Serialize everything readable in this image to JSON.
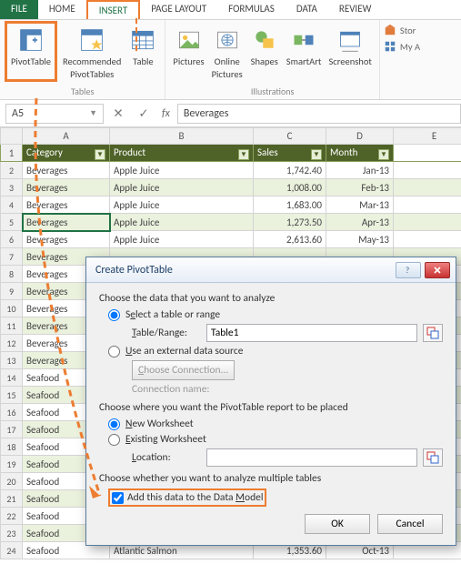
{
  "tabs": {
    "file": "FILE",
    "home": "HOME",
    "insert": "INSERT",
    "pagelayout": "PAGE LAYOUT",
    "formulas": "FORMULAS",
    "data": "DATA",
    "review": "REVIEW"
  },
  "ribbon": {
    "pivot": "PivotTable",
    "recpivot_l1": "Recommended",
    "recpivot_l2": "PivotTables",
    "table": "Table",
    "tables_group": "Tables",
    "pictures": "Pictures",
    "online_l1": "Online",
    "online_l2": "Pictures",
    "shapes": "Shapes",
    "smartart": "SmartArt",
    "screenshot": "Screenshot",
    "illus_group": "Illustrations",
    "store": "Stor",
    "myapps": "My A"
  },
  "namebox": "A5",
  "formula": "Beverages",
  "cols": [
    "A",
    "B",
    "C",
    "D",
    "E"
  ],
  "headers": {
    "category": "Category",
    "product": "Product",
    "sales": "Sales",
    "month": "Month"
  },
  "rows": [
    {
      "n": 2,
      "cat": "Beverages",
      "prod": "Apple Juice",
      "sales": "1,742.40",
      "mon": "Jan-13"
    },
    {
      "n": 3,
      "cat": "Beverages",
      "prod": "Apple Juice",
      "sales": "1,008.00",
      "mon": "Feb-13"
    },
    {
      "n": 4,
      "cat": "Beverages",
      "prod": "Apple Juice",
      "sales": "1,683.00",
      "mon": "Mar-13"
    },
    {
      "n": 5,
      "cat": "Beverages",
      "prod": "Apple Juice",
      "sales": "1,273.50",
      "mon": "Apr-13"
    },
    {
      "n": 6,
      "cat": "Beverages",
      "prod": "Apple Juice",
      "sales": "2,613.60",
      "mon": "May-13"
    },
    {
      "n": 7,
      "cat": "Beverages",
      "prod": "",
      "sales": "",
      "mon": ""
    },
    {
      "n": 8,
      "cat": "Beverages",
      "prod": "",
      "sales": "",
      "mon": ""
    },
    {
      "n": 9,
      "cat": "Beverages",
      "prod": "",
      "sales": "",
      "mon": ""
    },
    {
      "n": 10,
      "cat": "Beverages",
      "prod": "",
      "sales": "",
      "mon": ""
    },
    {
      "n": 11,
      "cat": "Beverages",
      "prod": "",
      "sales": "",
      "mon": ""
    },
    {
      "n": 12,
      "cat": "Beverages",
      "prod": "",
      "sales": "",
      "mon": ""
    },
    {
      "n": 13,
      "cat": "Beverages",
      "prod": "",
      "sales": "",
      "mon": ""
    },
    {
      "n": 14,
      "cat": "Seafood",
      "prod": "",
      "sales": "",
      "mon": ""
    },
    {
      "n": 15,
      "cat": "Seafood",
      "prod": "",
      "sales": "",
      "mon": ""
    },
    {
      "n": 16,
      "cat": "Seafood",
      "prod": "",
      "sales": "",
      "mon": ""
    },
    {
      "n": 17,
      "cat": "Seafood",
      "prod": "",
      "sales": "",
      "mon": ""
    },
    {
      "n": 18,
      "cat": "Seafood",
      "prod": "",
      "sales": "",
      "mon": ""
    },
    {
      "n": 19,
      "cat": "Seafood",
      "prod": "",
      "sales": "",
      "mon": ""
    },
    {
      "n": 20,
      "cat": "Seafood",
      "prod": "",
      "sales": "",
      "mon": ""
    },
    {
      "n": 21,
      "cat": "Seafood",
      "prod": "",
      "sales": "",
      "mon": ""
    },
    {
      "n": 22,
      "cat": "Seafood",
      "prod": "",
      "sales": "",
      "mon": ""
    },
    {
      "n": 23,
      "cat": "Seafood",
      "prod": "",
      "sales": "",
      "mon": ""
    },
    {
      "n": 24,
      "cat": "Seafood",
      "prod": "Atlantic Salmon",
      "sales": "1,353.60",
      "mon": "Oct-13"
    }
  ],
  "dialog": {
    "title": "Create PivotTable",
    "choose_data": "Choose the data that you want to analyze",
    "select_range_pre": "S",
    "select_range_u": "e",
    "select_range_post": "lect a table or range",
    "table_range_lbl_u": "T",
    "table_range_lbl_post": "able/Range:",
    "table_range_val": "Table1",
    "use_ext_pre": "",
    "use_ext_u": "U",
    "use_ext_post": "se an external data source",
    "choose_conn_u": "C",
    "choose_conn_post": "hoose Connection...",
    "conn_name": "Connection name:",
    "choose_place": "Choose where you want the PivotTable report to be placed",
    "new_ws_u": "N",
    "new_ws_post": "ew Worksheet",
    "exist_ws_u": "E",
    "exist_ws_post": "xisting Worksheet",
    "location_u": "L",
    "location_post": "ocation:",
    "choose_multi": "Choose whether you want to analyze multiple tables",
    "add_dm_pre": "Add this data to the Data ",
    "add_dm_u": "M",
    "add_dm_post": "odel",
    "ok": "OK",
    "cancel": "Cancel"
  }
}
